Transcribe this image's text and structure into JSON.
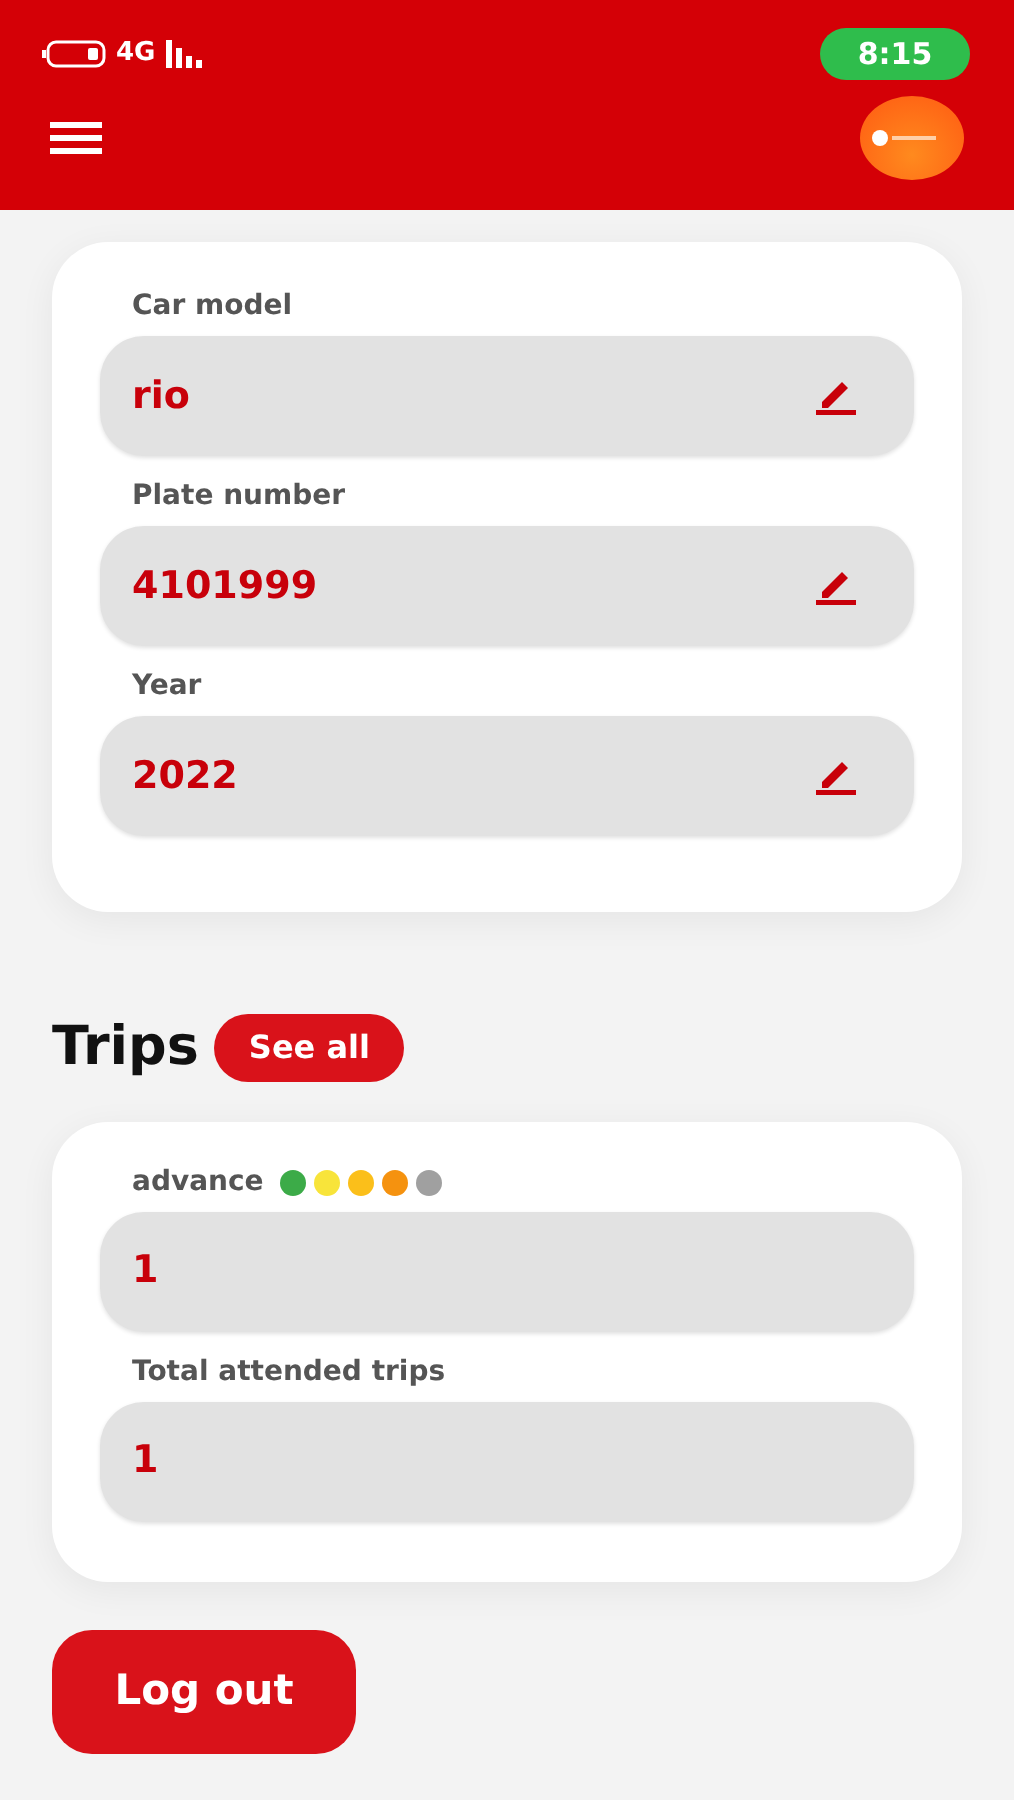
{
  "status_bar": {
    "network": "4G",
    "time": "8:15"
  },
  "car_fields": [
    {
      "label": "Car model",
      "value": "rio"
    },
    {
      "label": "Plate number",
      "value": "4101999"
    },
    {
      "label": "Year",
      "value": "2022"
    }
  ],
  "trips": {
    "title": "Trips",
    "see_all": "See all",
    "fields": [
      {
        "label": "advance",
        "value": "1",
        "dots": [
          {
            "color": "#3cab48"
          },
          {
            "color": "#f8e43a"
          },
          {
            "color": "#fbbf1a"
          },
          {
            "color": "#f5920f"
          },
          {
            "color": "#a0a0a0"
          }
        ]
      },
      {
        "label": "Total attended trips",
        "value": "1"
      }
    ]
  },
  "logout": "Log out"
}
